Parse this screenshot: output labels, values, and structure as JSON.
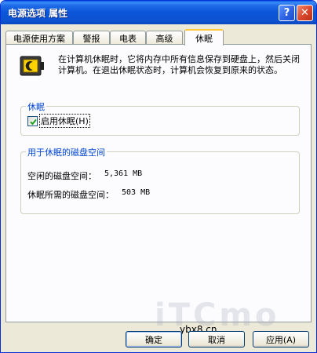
{
  "window": {
    "title": "电源选项 属性",
    "help_glyph": "?",
    "close_glyph": "✕"
  },
  "tabs": [
    {
      "label": "电源使用方案",
      "active": false
    },
    {
      "label": "警报",
      "active": false
    },
    {
      "label": "电表",
      "active": false
    },
    {
      "label": "高级",
      "active": false
    },
    {
      "label": "休眠",
      "active": true
    }
  ],
  "intro": {
    "icon": "hibernate-battery-icon",
    "text": "在计算机休眠时，它将内存中所有信息保存到硬盘上，然后关闭计算机。在退出休眠状态时，计算机会恢复到原来的状态。"
  },
  "hibernate_group": {
    "title": "休眠",
    "checkbox_label": "启用休眠(H)",
    "checked": true
  },
  "disk_group": {
    "title": "用于休眠的磁盘空间",
    "free_label": "空闲的磁盘空间：",
    "free_value": "5,361 MB",
    "required_label": "休眠所需的磁盘空间：",
    "required_value": "503 MB"
  },
  "watermark": {
    "logo": "iTCmo",
    "site": "ybx8.cn"
  },
  "buttons": {
    "ok": "确定",
    "cancel": "取消",
    "apply": "应用(A)"
  },
  "colors": {
    "titlebar": "#0b55d8",
    "group_title": "#0046d5",
    "active_tab_accent": "#ffc83c",
    "window_bg": "#ece9d8"
  }
}
